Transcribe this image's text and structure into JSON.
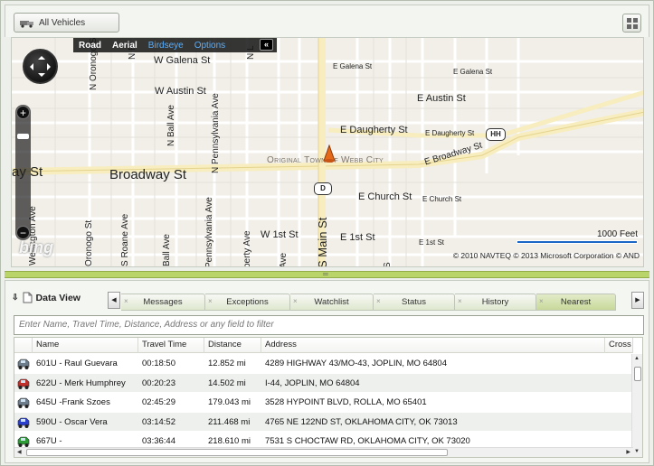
{
  "toolbar": {
    "vehicles_label": "All Vehicles"
  },
  "map": {
    "nav": {
      "road": "Road",
      "aerial": "Aerial",
      "birdseye": "Birdseye",
      "options": "Options",
      "collapse": "«"
    },
    "streets": {
      "galena_w": "W Galena St",
      "galena_e1": "E Galena St",
      "galena_e2": "E Galena St",
      "austin_w": "W Austin St",
      "austin_e": "E Austin St",
      "daugherty_e1": "E Daugherty St",
      "daugherty_e2": "E Daugherty St",
      "broadway": "Broadway St",
      "broadway_w": "ay St",
      "broadway_e": "E Broadway St",
      "church_e1": "E Church St",
      "church_e2": "E Church St",
      "first_w": "W 1st St",
      "first_e1": "E 1st St",
      "first_e2": "E 1st St",
      "oronogo_n": "N Oronogo St",
      "oronogo_s": "Oronogo St",
      "roane": "S Roane Ave",
      "ball_n": "N Ball Ave",
      "ball_s": "Ball Ave",
      "penn_n": "N Pennsylvania Ave",
      "penn_s": "Pennsylvania Ave",
      "liberty": "berty Ave",
      "main_s": "S Main St",
      "wellington": "Wellington Ave",
      "n_r": "N R",
      "n_l": "N L",
      "s_ave": "S ",
      "ave_frag": "Ave"
    },
    "town": "Original Town of Webb City",
    "shields": {
      "hh": "HH",
      "d": "D"
    },
    "scale_label": "1000 Feet",
    "copyright": "© 2010 NAVTEQ   © 2013 Microsoft Corporation   © AND",
    "brand": "bing"
  },
  "dataview": {
    "title": "Data View",
    "tabs": [
      "Messages",
      "Exceptions",
      "Watchlist",
      "Status",
      "History",
      "Nearest"
    ],
    "active_tab": "Nearest",
    "filter_placeholder": "Enter Name, Travel Time, Distance, Address or any field to filter",
    "columns": [
      "Name",
      "Travel Time",
      "Distance",
      "Address",
      "Cross"
    ],
    "rows": [
      {
        "name": "601U - Raul Guevara",
        "time": "00:18:50",
        "distance": "12.852 mi",
        "address": "4289 HIGHWAY 43/MO-43, JOPLIN, MO 64804",
        "color": "#6d7c8a"
      },
      {
        "name": "622U - Merk Humphrey",
        "time": "00:20:23",
        "distance": "14.502 mi",
        "address": "I-44, JOPLIN, MO 64804",
        "color": "#c0302a"
      },
      {
        "name": "645U -Frank Szoes",
        "time": "02:45:29",
        "distance": "179.043 mi",
        "address": "3528 HYPOINT BLVD, ROLLA, MO 65401",
        "color": "#6d7c8a"
      },
      {
        "name": "590U - Oscar Vera",
        "time": "03:14:52",
        "distance": "211.468 mi",
        "address": "4765 NE 122ND ST, OKLAHOMA CITY, OK 73013",
        "color": "#2a3fcc"
      },
      {
        "name": "667U -",
        "time": "03:36:44",
        "distance": "218.610 mi",
        "address": "7531 S CHOCTAW RD, OKLAHOMA CITY, OK 73020",
        "color": "#2e9a36"
      }
    ]
  }
}
